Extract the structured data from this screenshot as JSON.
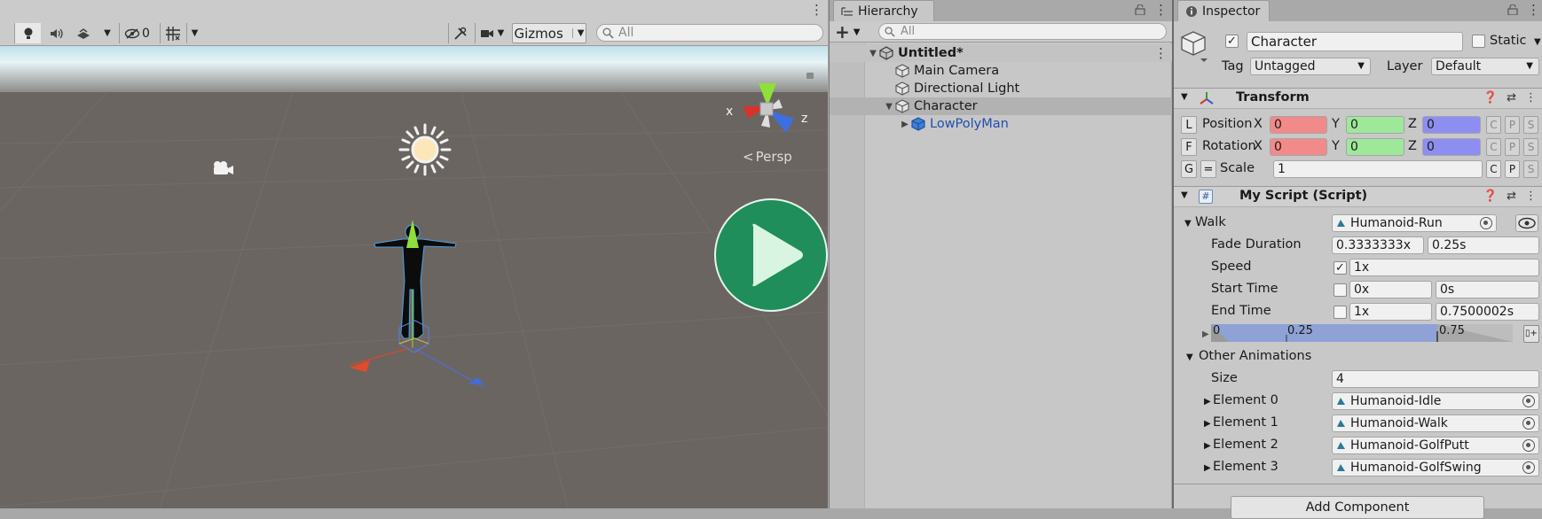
{
  "scene": {
    "toolbar": {
      "hidden_count": "0",
      "gizmos_label": "Gizmos",
      "search_placeholder": "All"
    },
    "persp_label": "Persp",
    "axis_x": "x",
    "axis_z": "z"
  },
  "hierarchy": {
    "tab_label": "Hierarchy",
    "search_placeholder": "All",
    "add_label": "+",
    "items": [
      {
        "label": "Untitled*"
      },
      {
        "label": "Main Camera"
      },
      {
        "label": "Directional Light"
      },
      {
        "label": "Character"
      },
      {
        "label": "LowPolyMan"
      }
    ]
  },
  "inspector": {
    "tab_label": "Inspector",
    "object_name": "Character",
    "static_label": "Static",
    "tag_label": "Tag",
    "tag_value": "Untagged",
    "layer_label": "Layer",
    "layer_value": "Default",
    "transform": {
      "title": "Transform",
      "position_label": "Position",
      "rotation_label": "Rotation",
      "scale_label": "Scale",
      "L": "L",
      "F": "F",
      "G": "G",
      "eq": "=",
      "x": "X",
      "y": "Y",
      "z": "Z",
      "position": {
        "x": "0",
        "y": "0",
        "z": "0"
      },
      "rotation": {
        "x": "0",
        "y": "0",
        "z": "0"
      },
      "scale": "1",
      "c": "C",
      "p": "P",
      "s": "S"
    },
    "script": {
      "title": "My Script (Script)",
      "walk_label": "Walk",
      "walk_value": "Humanoid-Run",
      "fade_label": "Fade Duration",
      "fade_x": "0.3333333x",
      "fade_s": "0.25s",
      "speed_label": "Speed",
      "speed_value": "1x",
      "start_label": "Start Time",
      "start_x": "0x",
      "start_s": "0s",
      "end_label": "End Time",
      "end_x": "1x",
      "end_s": "0.7500002s",
      "timeline": {
        "t0": "0",
        "t1": "0.25",
        "t2": "0.75",
        "progress": 0.75
      },
      "other_label": "Other Animations",
      "size_label": "Size",
      "size_value": "4",
      "elements": [
        {
          "label": "Element 0",
          "value": "Humanoid-Idle"
        },
        {
          "label": "Element 1",
          "value": "Humanoid-Walk"
        },
        {
          "label": "Element 2",
          "value": "Humanoid-GolfPutt"
        },
        {
          "label": "Element 3",
          "value": "Humanoid-GolfSwing"
        }
      ]
    },
    "add_component_label": "Add Component"
  },
  "colors": {
    "x_field": "#f28a8a",
    "y_field": "#9ee89a",
    "z_field": "#8e8ef2",
    "play_button": "#1f8e5a"
  }
}
